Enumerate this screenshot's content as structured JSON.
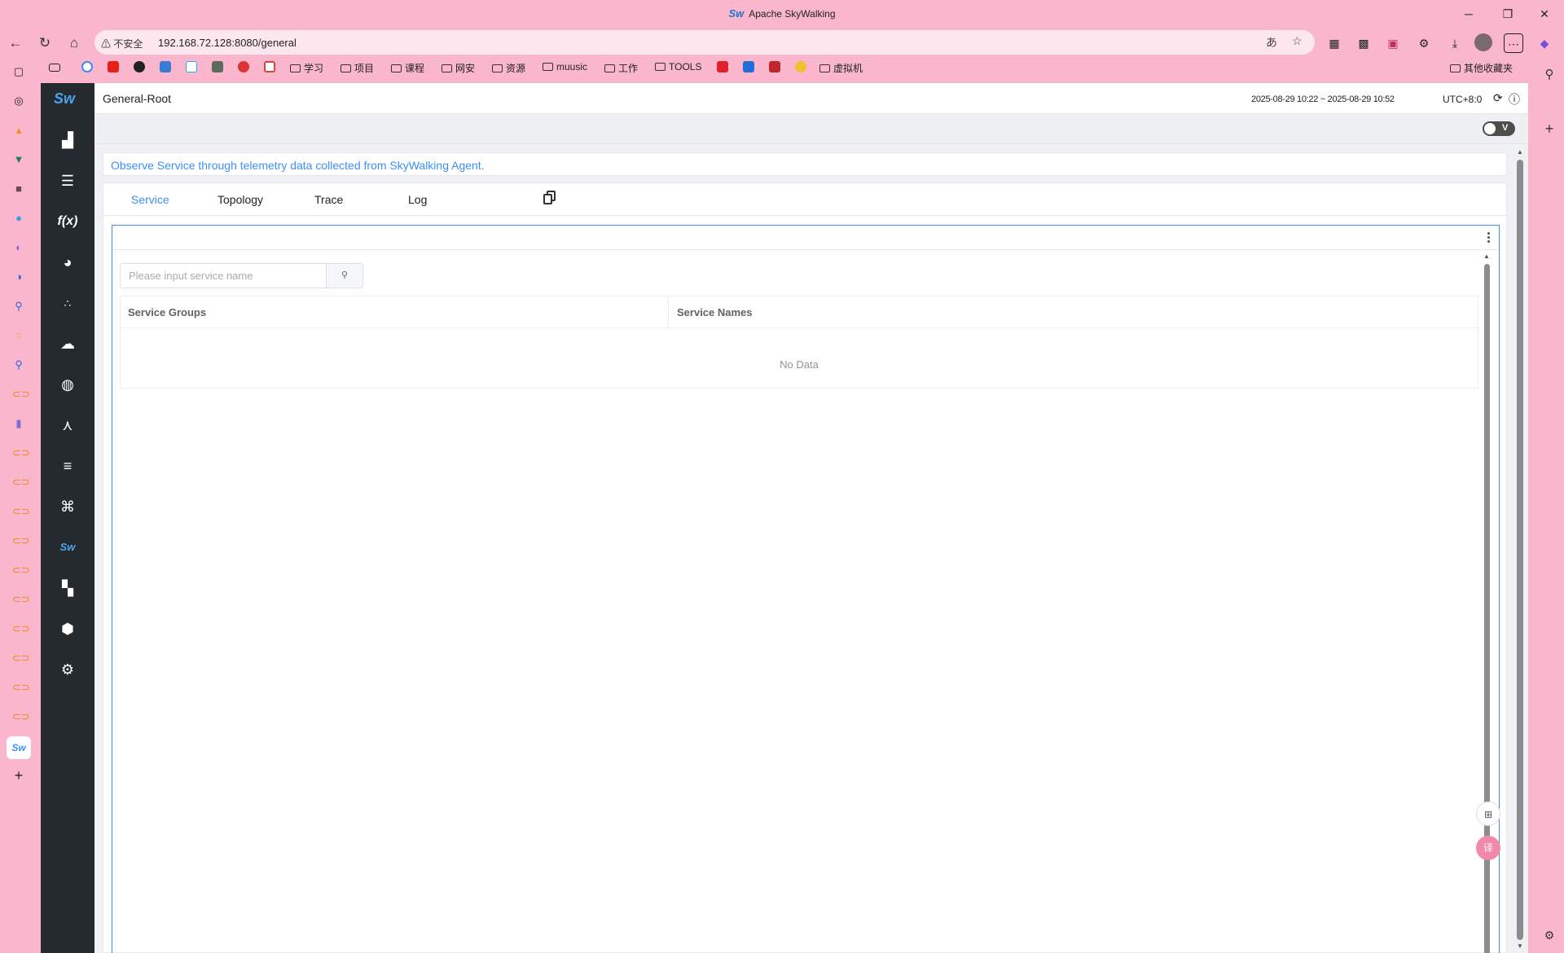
{
  "browser": {
    "title": "Apache SkyWalking",
    "title_logo": "Sw",
    "security_label": "不安全",
    "url": "192.168.72.128:8080/general",
    "bookmarks": [
      "学习",
      "项目",
      "课程",
      "网安",
      "资源",
      "muusic",
      "工作",
      "TOOLS",
      "虚拟机"
    ],
    "other_bookmarks": "其他收藏夹"
  },
  "app": {
    "logo": "Sw",
    "breadcrumb": "General-Root",
    "time_range": "2025-08-29 10:22 ~ 2025-08-29 10:52",
    "timezone": "UTC+8:0",
    "toggle_label": "V",
    "description": "Observe Service through telemetry data collected from SkyWalking Agent.",
    "tabs": [
      {
        "label": "Service",
        "active": true
      },
      {
        "label": "Topology",
        "active": false
      },
      {
        "label": "Trace",
        "active": false
      },
      {
        "label": "Log",
        "active": false
      }
    ],
    "search": {
      "placeholder": "Please input service name",
      "value": ""
    },
    "table": {
      "columns": [
        "Service Groups",
        "Service Names"
      ],
      "rows": [],
      "empty_text": "No Data"
    },
    "nav_icons": [
      "chart-icon",
      "database-icon",
      "function-icon",
      "pie-chart-icon",
      "nodes-icon",
      "cloud-icon",
      "globe-icon",
      "mesh-icon",
      "list-icon",
      "network-icon",
      "skywalking-icon",
      "dashboard-add-icon",
      "alarm-icon",
      "settings-icon"
    ]
  },
  "colors": {
    "accent": "#3c8ff7",
    "nav_bg": "#252a2f",
    "browser_bg": "#f9b6cc"
  }
}
